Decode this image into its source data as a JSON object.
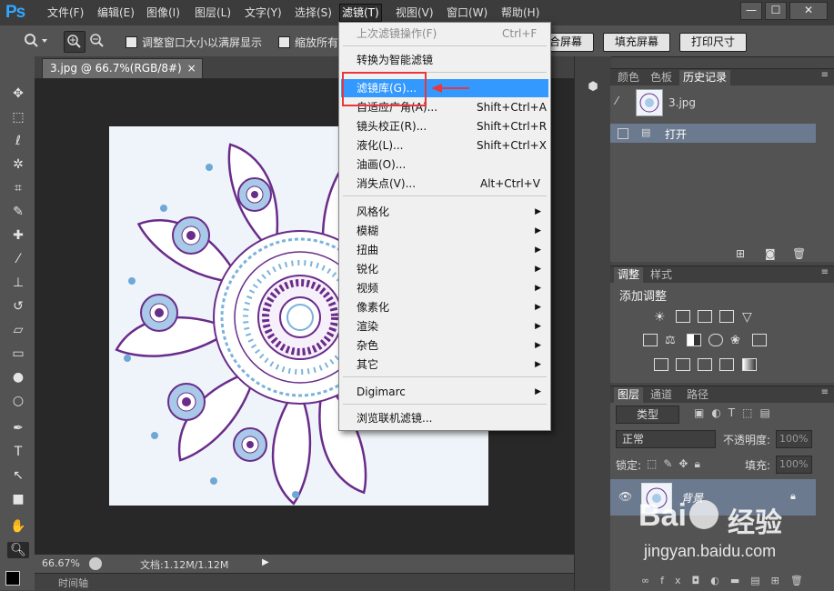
{
  "app": {
    "logo": "Ps"
  },
  "menubar": {
    "items": [
      "文件(F)",
      "编辑(E)",
      "图像(I)",
      "图层(L)",
      "文字(Y)",
      "选择(S)",
      "滤镜(T)",
      "视图(V)",
      "窗口(W)",
      "帮助(H)"
    ],
    "active": "滤镜(T)"
  },
  "window_controls": [
    "—",
    "☐",
    "✕"
  ],
  "options": {
    "resize_label": "调整窗口大小以满屏显示",
    "zoom_all_label": "缩放所有",
    "fit_screen": "适合屏幕",
    "fill_screen": "填充屏幕",
    "print_size": "打印尺寸"
  },
  "document": {
    "tab_title": "3.jpg @ 66.7%(RGB/8#)",
    "close": "×",
    "zoom": "66.67%",
    "doc_info": "文档:1.12M/1.12M",
    "timeline": "时间轴"
  },
  "filter_menu": {
    "last_filter": {
      "label": "上次滤镜操作(F)",
      "shortcut": "Ctrl+F"
    },
    "smart": "转换为智能滤镜",
    "items": [
      {
        "label": "滤镜库(G)...",
        "shortcut": ""
      },
      {
        "label": "自适应广角(A)...",
        "shortcut": "Shift+Ctrl+A"
      },
      {
        "label": "镜头校正(R)...",
        "shortcut": "Shift+Ctrl+R"
      },
      {
        "label": "液化(L)...",
        "shortcut": "Shift+Ctrl+X"
      },
      {
        "label": "油画(O)...",
        "shortcut": ""
      },
      {
        "label": "消失点(V)...",
        "shortcut": "Alt+Ctrl+V"
      }
    ],
    "submenus": [
      "风格化",
      "模糊",
      "扭曲",
      "锐化",
      "视频",
      "像素化",
      "渲染",
      "杂色",
      "其它"
    ],
    "digimarc": "Digimarc",
    "browse": "浏览联机滤镜..."
  },
  "panels": {
    "history": {
      "tabs": [
        "颜色",
        "色板",
        "历史记录"
      ],
      "active": "历史记录",
      "snapshot": "3.jpg",
      "step": "打开"
    },
    "adjustments": {
      "tabs": [
        "调整",
        "样式"
      ],
      "title": "添加调整"
    },
    "layers": {
      "tabs": [
        "图层",
        "通道",
        "路径"
      ],
      "filter_kind": "类型",
      "blend_mode": "正常",
      "opacity_label": "不透明度:",
      "opacity_value": "100%",
      "lock_label": "锁定:",
      "fill_label": "填充:",
      "fill_value": "100%",
      "layer_name": "背景"
    }
  },
  "watermark": {
    "brand": "Bai",
    "brand2": "经验",
    "url": "jingyan.baidu.com"
  },
  "colors": {
    "accent": "#3399ff",
    "highlight_box": "#e8383d",
    "ps_blue": "#31a8ff"
  }
}
